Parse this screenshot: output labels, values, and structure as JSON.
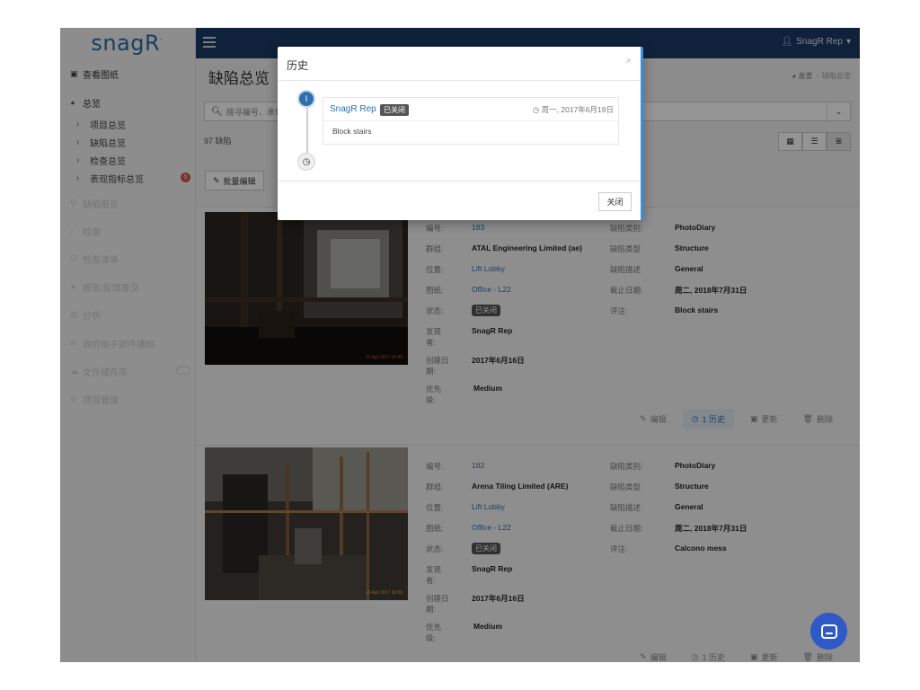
{
  "app": {
    "logo": "snagR"
  },
  "sidebar": {
    "view_drawings": "查看图纸",
    "overview": "总览",
    "sub_items": [
      "项目总览",
      "缺陷总览",
      "检查总览",
      "表现指标总览"
    ],
    "kpi_badge": "0",
    "faded_items": [
      "缺陷报告",
      "检查",
      "检查清单",
      "报告/反馈意见",
      "分析",
      "我的电子邮件通知",
      "文件储存库",
      "项目管理"
    ]
  },
  "topbar": {
    "user": "SnagR Rep"
  },
  "page": {
    "title": "缺陷总览",
    "breadcrumb_home": "总览",
    "breadcrumb_current": "缺陷总览",
    "search_placeholder": "搜寻编号、承包",
    "count": "97 缺陷",
    "bulk_edit": "批量编辑"
  },
  "labels": {
    "number": "编号:",
    "group": "群组:",
    "location": "位置:",
    "drawing": "图纸:",
    "status": "状态:",
    "finder": "发现者:",
    "created": "创建日期:",
    "priority": "优先级:",
    "category": "缺陷类别:",
    "type": "缺陷类型",
    "desc": "缺陷描述",
    "due": "截止日期:",
    "comment": "评注:"
  },
  "actions": {
    "edit": "编辑",
    "history": "1 历史",
    "update": "更新",
    "delete": "删除"
  },
  "snags": [
    {
      "number": "183",
      "group": "ATAL Engineering Limited  (ae)",
      "location": "Lift Lobby",
      "drawing": "Office - L22",
      "status": "已关闭",
      "finder": "SnagR Rep",
      "created": "2017年6月16日",
      "priority": "Medium",
      "category": "PhotoDiary",
      "type": "Structure",
      "desc": "General",
      "due": "周二, 2018年7月31日",
      "comment": "Block stairs",
      "photo_stamp": "11 Apr 2017 16:40"
    },
    {
      "number": "182",
      "group": "Arena Tiling Limited  (ARE)",
      "location": "Lift Lobby",
      "drawing": "Office - L22",
      "status": "已关闭",
      "finder": "SnagR Rep",
      "created": "2017年6月16日",
      "priority": "Medium",
      "category": "PhotoDiary",
      "type": "Structure",
      "desc": "General",
      "due": "周二, 2018年7月31日",
      "comment": "Calcono mess",
      "photo_stamp": "11 Apr 2017 16:39"
    }
  ],
  "modal": {
    "title": "历史",
    "entry_number": "I",
    "entry_user": "SnagR Rep",
    "entry_status": "已关闭",
    "entry_date": "周一, 2017年6月19日",
    "entry_comment": "Block stairs",
    "close_button": "关闭"
  },
  "colors": {
    "topbar": "#1c3a66",
    "accent": "#2f6fb0",
    "chat": "#2f59c6"
  },
  "icons": [
    "picture-icon",
    "dashboard-icon",
    "chevron-right-icon",
    "search-icon",
    "chevron-down-icon",
    "grid-icon",
    "list-icon",
    "lines-icon",
    "pencil-icon",
    "clock-icon",
    "camera-icon",
    "trash-icon",
    "user-icon",
    "chat-icon"
  ]
}
